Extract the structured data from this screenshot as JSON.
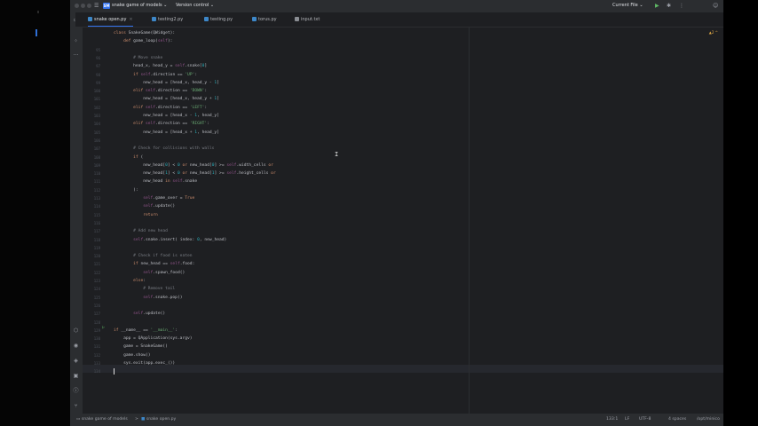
{
  "window": {
    "project_badge": "SM",
    "project_name": "snake game of models",
    "vcs_label": "Version control",
    "run_config": "Current File"
  },
  "tabs": [
    {
      "label": "snake open.py",
      "active": true
    },
    {
      "label": "testing2.py"
    },
    {
      "label": "testing.py"
    },
    {
      "label": "torus.py"
    },
    {
      "label": "input.txt"
    }
  ],
  "editor": {
    "inspection": "▲2 ^"
  },
  "code_lines": [
    {
      "n": "",
      "t": "class SnakeGame(QWidget):"
    },
    {
      "n": "",
      "t": "    def game_loop(self):"
    },
    {
      "n": "95",
      "t": ""
    },
    {
      "n": "96",
      "t": "        # Move snake"
    },
    {
      "n": "97",
      "t": "        head_x, head_y = self.snake[0]"
    },
    {
      "n": "98",
      "t": "        if self.direction == 'UP':"
    },
    {
      "n": "99",
      "t": "            new_head = [head_x, head_y - 1]"
    },
    {
      "n": "100",
      "t": "        elif self.direction == 'DOWN':"
    },
    {
      "n": "101",
      "t": "            new_head = [head_x, head_y + 1]"
    },
    {
      "n": "102",
      "t": "        elif self.direction == 'LEFT':"
    },
    {
      "n": "103",
      "t": "            new_head = [head_x - 1, head_y]"
    },
    {
      "n": "104",
      "t": "        elif self.direction == 'RIGHT':"
    },
    {
      "n": "105",
      "t": "            new_head = [head_x + 1, head_y]"
    },
    {
      "n": "106",
      "t": ""
    },
    {
      "n": "107",
      "t": "        # Check for collisions with walls"
    },
    {
      "n": "108",
      "t": "        if ("
    },
    {
      "n": "109",
      "t": "            new_head[0] < 0 or new_head[0] >= self.width_cells or"
    },
    {
      "n": "110",
      "t": "            new_head[1] < 0 or new_head[1] >= self.height_cells or"
    },
    {
      "n": "111",
      "t": "            new_head in self.snake"
    },
    {
      "n": "112",
      "t": "        ):"
    },
    {
      "n": "113",
      "t": "            self.game_over = True"
    },
    {
      "n": "114",
      "t": "            self.update()"
    },
    {
      "n": "115",
      "t": "            return"
    },
    {
      "n": "116",
      "t": ""
    },
    {
      "n": "117",
      "t": "        # Add new head"
    },
    {
      "n": "118",
      "t": "        self.snake.insert( index: 0, new_head)"
    },
    {
      "n": "119",
      "t": ""
    },
    {
      "n": "120",
      "t": "        # Check if food is eaten"
    },
    {
      "n": "121",
      "t": "        if new_head == self.food:"
    },
    {
      "n": "122",
      "t": "            self.spawn_food()"
    },
    {
      "n": "123",
      "t": "        else:"
    },
    {
      "n": "124",
      "t": "            # Remove tail"
    },
    {
      "n": "125",
      "t": "            self.snake.pop()"
    },
    {
      "n": "126",
      "t": ""
    },
    {
      "n": "127",
      "t": "        self.update()"
    },
    {
      "n": "128",
      "t": ""
    },
    {
      "n": "129",
      "t": "if __name__ == '__main__':"
    },
    {
      "n": "130",
      "t": "    app = QApplication(sys.argv)"
    },
    {
      "n": "131",
      "t": "    game = SnakeGame()"
    },
    {
      "n": "132",
      "t": "    game.show()"
    },
    {
      "n": "133",
      "t": "    sys.exit(app.exec_())"
    },
    {
      "n": "134",
      "t": ""
    }
  ],
  "statusbar": {
    "breadcrumb_project": "snake game of models",
    "breadcrumb_sep": ">",
    "breadcrumb_file": "snake open.py",
    "position": "133:1",
    "line_sep": "LF",
    "encoding": "UTF-8",
    "indent": "4 spaces",
    "interpreter": "/opt/minico"
  }
}
